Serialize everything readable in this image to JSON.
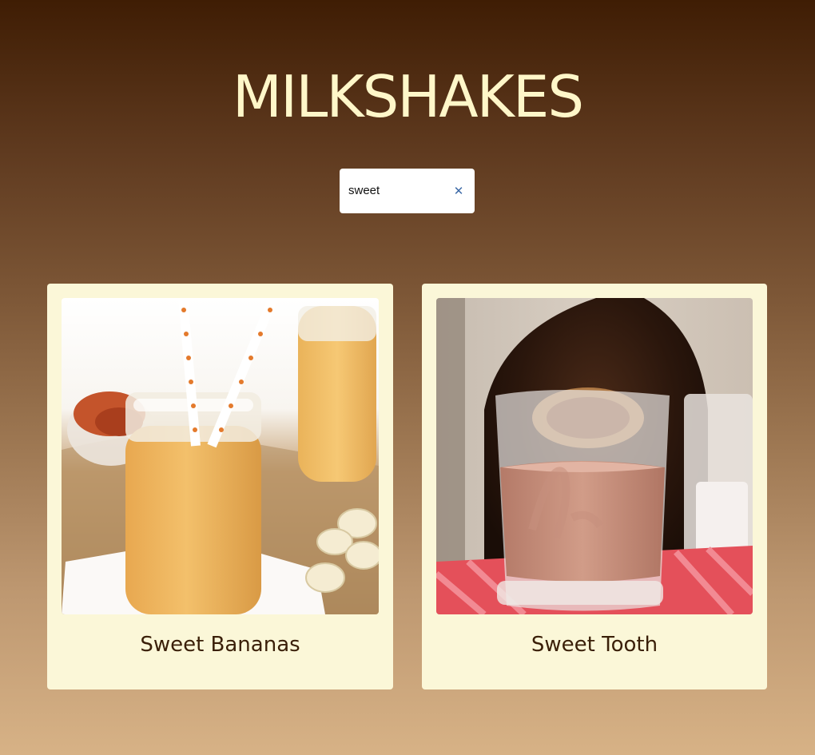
{
  "header": {
    "title": "MILKSHAKES"
  },
  "search": {
    "value": "sweet",
    "clear_icon": "close-icon",
    "clear_glyph": "✕"
  },
  "results": [
    {
      "title": "Sweet Bananas",
      "image_icon": "banana-milkshake-photo"
    },
    {
      "title": "Sweet Tooth",
      "image_icon": "chocolate-milk-glass-photo"
    }
  ],
  "colors": {
    "title": "#fff7c9",
    "card_bg": "#fbf7d8",
    "card_text": "#3a1f08",
    "clear_icon": "#3d6aa7"
  }
}
